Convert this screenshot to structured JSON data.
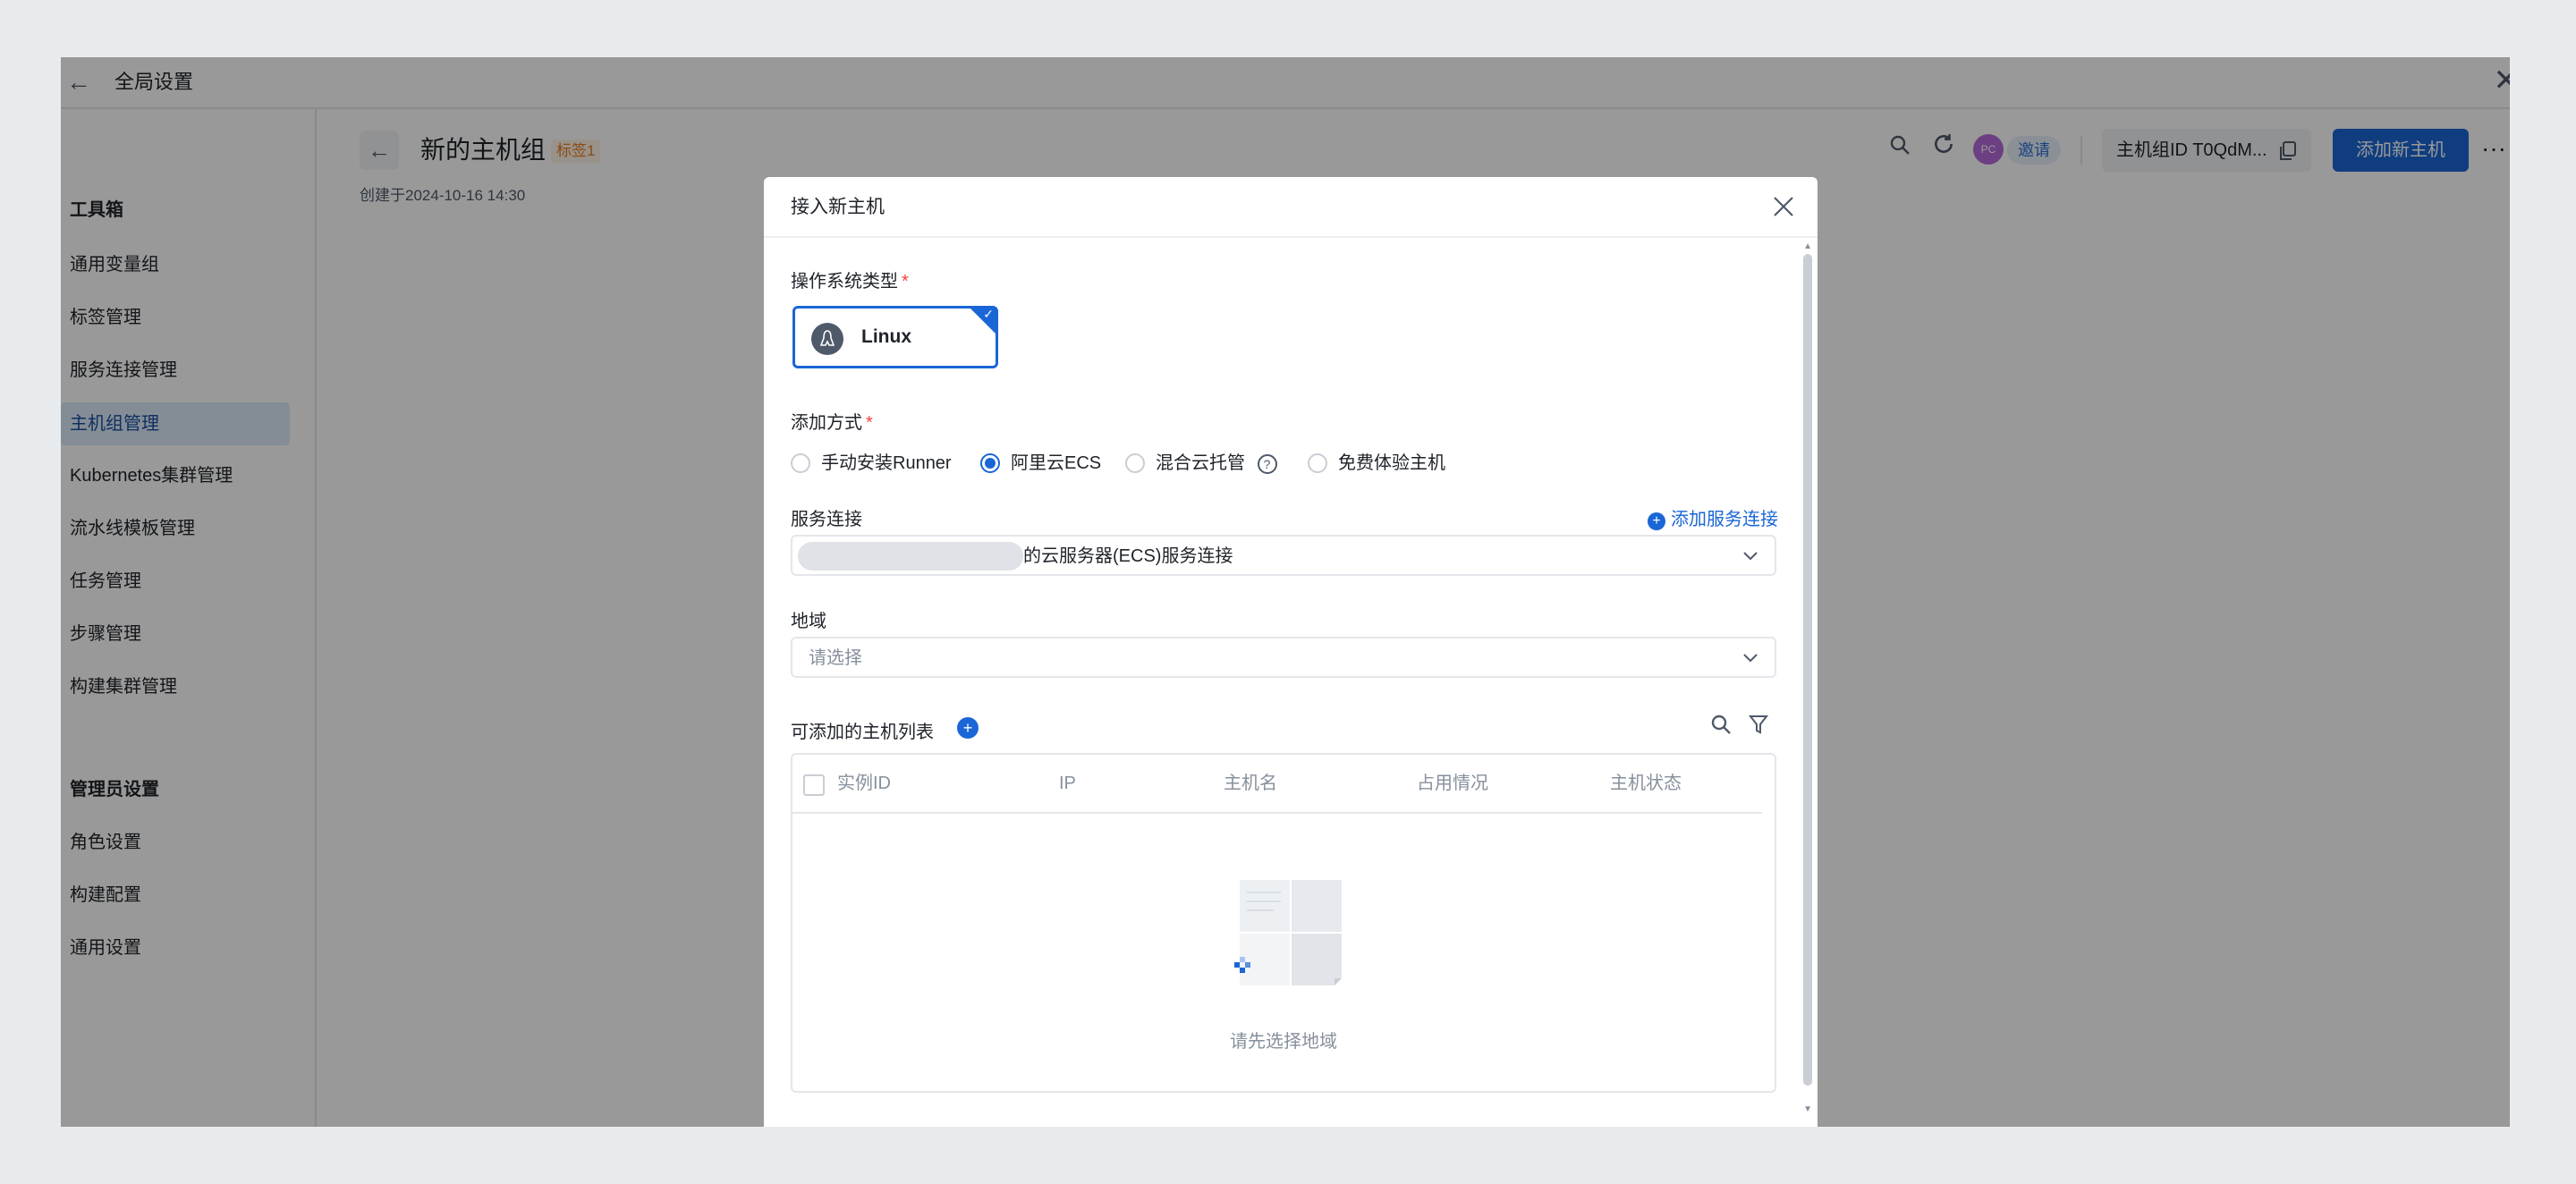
{
  "window": {
    "title": "全局设置",
    "back_icon": "←",
    "close_icon": "✕"
  },
  "sidebar": {
    "toolbox_heading": "工具箱",
    "items": [
      {
        "label": "通用变量组"
      },
      {
        "label": "标签管理"
      },
      {
        "label": "服务连接管理"
      },
      {
        "label": "主机组管理",
        "active": true
      },
      {
        "label": "Kubernetes集群管理"
      },
      {
        "label": "流水线模板管理"
      },
      {
        "label": "任务管理"
      },
      {
        "label": "步骤管理"
      },
      {
        "label": "构建集群管理"
      }
    ],
    "admin_heading": "管理员设置",
    "admin_items": [
      {
        "label": "角色设置"
      },
      {
        "label": "构建配置"
      },
      {
        "label": "通用设置"
      }
    ]
  },
  "main": {
    "title": "新的主机组",
    "tag": "标签1",
    "subtitle": "创建于2024-10-16 14:30",
    "toolbar": {
      "avatar_text": "PC",
      "invite_label": "邀请",
      "host_group_id": "主机组ID T0QdM...",
      "add_host_label": "添加新主机",
      "more_icon": "···"
    }
  },
  "modal": {
    "title": "接入新主机",
    "os_type_label": "操作系统类型",
    "required_mark": "*",
    "os_option": "Linux",
    "add_method_label": "添加方式",
    "methods": [
      {
        "label": "手动安装Runner",
        "checked": false
      },
      {
        "label": "阿里云ECS",
        "checked": true
      },
      {
        "label": "混合云托管",
        "checked": false
      },
      {
        "label": "免费体验主机",
        "checked": false
      }
    ],
    "service_conn_label": "服务连接",
    "add_service_conn": "添加服务连接",
    "service_conn_value": "的云服务器(ECS)服务连接",
    "region_label": "地域",
    "region_placeholder": "请选择",
    "host_list_title": "可添加的主机列表",
    "columns": [
      "实例ID",
      "IP",
      "主机名",
      "占用情况",
      "主机状态"
    ],
    "empty_text": "请先选择地域"
  },
  "colors": {
    "primary": "#1a66d6",
    "sidebar_active_bg": "#ddebfb",
    "tag_text": "#e67e22",
    "overlay": "rgba(0,0,0,0.40)"
  },
  "icons": {
    "search": "search-icon",
    "refresh": "refresh-icon",
    "copy": "copy-icon",
    "filter": "filter-icon",
    "help": "help-icon",
    "linux": "linux-icon"
  }
}
